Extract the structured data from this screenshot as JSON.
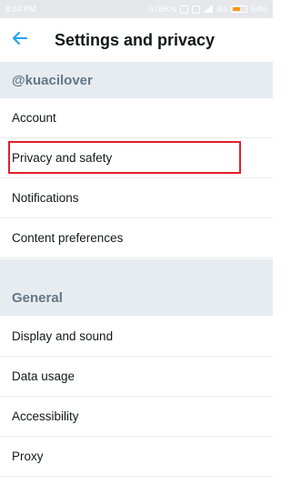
{
  "status_bar": {
    "time": "8:04 PM",
    "network_speed": "0.05K/s",
    "network_type": "4G",
    "battery_text": "54%",
    "battery_level": 0.54,
    "battery_color": "#ff9800"
  },
  "app_bar": {
    "back_icon": "arrow-left-icon",
    "title": "Settings and privacy",
    "accent_color": "#1da1f2"
  },
  "account_section": {
    "header": "@kuacilover",
    "items": [
      {
        "label": "Account"
      },
      {
        "label": "Privacy and safety"
      },
      {
        "label": "Notifications"
      },
      {
        "label": "Content preferences"
      }
    ]
  },
  "general_section": {
    "header": "General",
    "items": [
      {
        "label": "Display and sound"
      },
      {
        "label": "Data usage"
      },
      {
        "label": "Accessibility"
      },
      {
        "label": "Proxy"
      }
    ]
  },
  "annotation": {
    "highlighted_item": "Privacy and safety",
    "color": "#e0202a"
  }
}
